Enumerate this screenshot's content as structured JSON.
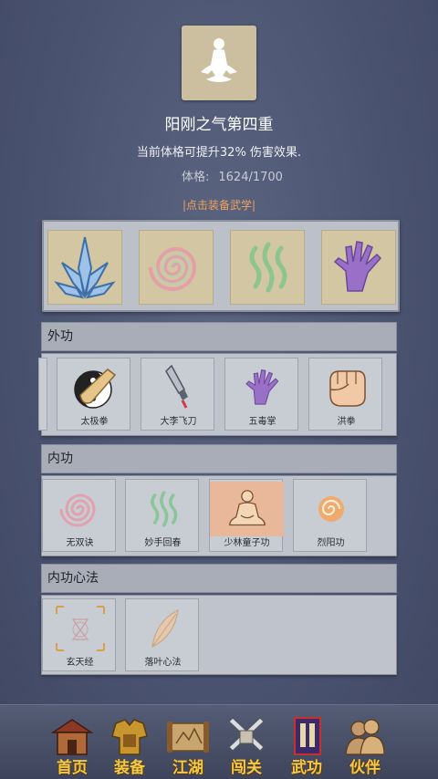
{
  "skill": {
    "title": "阳刚之气第四重",
    "description": "当前体格可提升32% 伤害效果.",
    "stat_label": "体格:",
    "stat_value": "1624/1700",
    "equip_hint": "|点击装备武学|"
  },
  "sections": {
    "outer": {
      "header": "外功",
      "items": [
        {
          "label": "太极拳",
          "icon": "taiji-fist-icon"
        },
        {
          "label": "大李飞刀",
          "icon": "flying-knife-icon"
        },
        {
          "label": "五毒掌",
          "icon": "poison-palm-icon"
        },
        {
          "label": "洪拳",
          "icon": "fist-icon"
        }
      ]
    },
    "inner": {
      "header": "内功",
      "items": [
        {
          "label": "无双诀",
          "icon": "swirl-icon"
        },
        {
          "label": "妙手回春",
          "icon": "healing-wave-icon"
        },
        {
          "label": "少林童子功",
          "icon": "meditating-monk-icon"
        },
        {
          "label": "烈阳功",
          "icon": "sun-swirl-icon"
        }
      ]
    },
    "mind": {
      "header": "内功心法",
      "items": [
        {
          "label": "玄天经",
          "icon": "sigil-icon"
        },
        {
          "label": "落叶心法",
          "icon": "leaf-icon"
        }
      ]
    }
  },
  "nav": [
    {
      "label": "首页",
      "icon": "house-icon"
    },
    {
      "label": "装备",
      "icon": "armor-icon"
    },
    {
      "label": "江湖",
      "icon": "scroll-map-icon"
    },
    {
      "label": "闯关",
      "icon": "swords-icon"
    },
    {
      "label": "武功",
      "icon": "book-icon"
    },
    {
      "label": "伙伴",
      "icon": "companions-icon"
    }
  ],
  "colors": {
    "background": "#4a5370",
    "accent_orange": "#f0a25c",
    "nav_text": "#f2c94a"
  }
}
